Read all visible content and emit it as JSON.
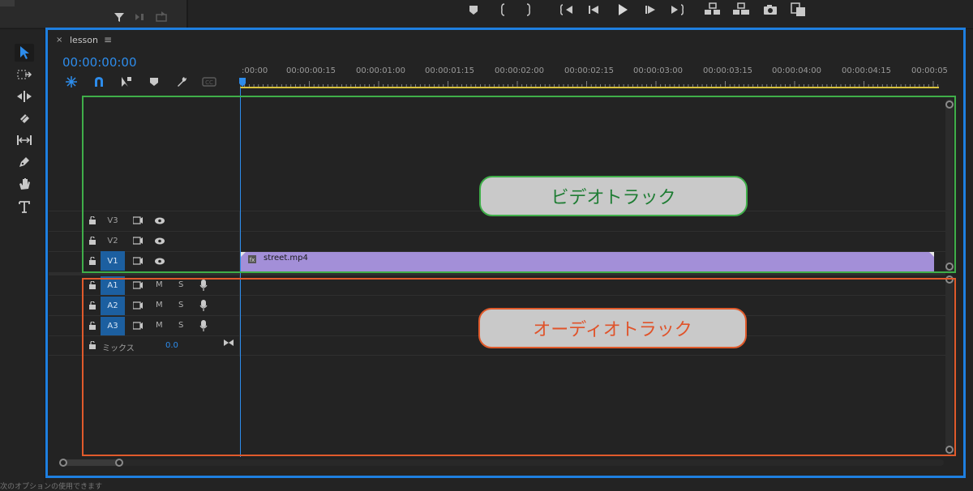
{
  "sequence": {
    "tab_title": "lesson",
    "timecode": "00:00:00:00"
  },
  "ruler": {
    "ticks": [
      ":00:00",
      "00:00:00:15",
      "00:00:01:00",
      "00:00:01:15",
      "00:00:02:00",
      "00:00:02:15",
      "00:00:03:00",
      "00:00:03:15",
      "00:00:04:00",
      "00:00:04:15",
      "00:00:05"
    ]
  },
  "tracks": {
    "video": [
      {
        "id": "V3",
        "active": false
      },
      {
        "id": "V2",
        "active": false
      },
      {
        "id": "V1",
        "active": true
      }
    ],
    "audio": [
      {
        "id": "A1",
        "m": "M",
        "s": "S"
      },
      {
        "id": "A2",
        "m": "M",
        "s": "S"
      },
      {
        "id": "A3",
        "m": "M",
        "s": "S"
      }
    ],
    "mix": {
      "label": "ミックス",
      "value": "0.0"
    }
  },
  "clip": {
    "name": "street.mp4",
    "color": "#a38fd8"
  },
  "annotations": {
    "video_label": "ビデオトラック",
    "audio_label": "オーディオトラック",
    "video_color": "#3fae49",
    "audio_color": "#e05a2b",
    "panel_color": "#1e7fe0"
  },
  "status_text": "次のオプションの使用できます",
  "icons": [
    "filter-icon",
    "insert-icon",
    "export-frame-icon",
    "marker-icon",
    "mark-in-icon",
    "mark-out-icon",
    "go-to-in-icon",
    "step-back-icon",
    "play-icon",
    "step-forward-icon",
    "go-to-out-icon",
    "lift-icon",
    "extract-icon",
    "camera-icon",
    "compare-icon",
    "selection-tool-icon",
    "track-select-tool-icon",
    "ripple-edit-tool-icon",
    "razor-tool-icon",
    "slip-tool-icon",
    "pen-tool-icon",
    "hand-tool-icon",
    "type-tool-icon"
  ]
}
